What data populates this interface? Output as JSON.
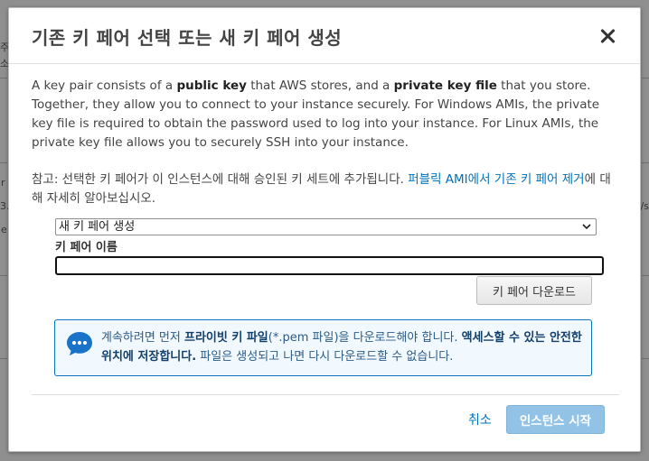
{
  "background": {
    "fragments": [
      "주",
      "소",
      "r",
      "3.",
      "e",
      "/s"
    ]
  },
  "dialog": {
    "title": "기존 키 페어 선택 또는 새 키 페어 생성",
    "description": {
      "p1": "A key pair consists of a ",
      "b1": "public key",
      "p2": " that AWS stores, and a ",
      "b2": "private key file",
      "p3": " that you store. Together, they allow you to connect to your instance securely. For Windows AMIs, the private key file is required to obtain the password used to log into your instance. For Linux AMIs, the private key file allows you to securely SSH into your instance."
    },
    "note": {
      "text": "참고: 선택한 키 페어가 이 인스턴스에 대해 승인된 키 세트에 추가됩니다. ",
      "link": "퍼블릭 AMI에서 기존 키 페어 제거",
      "suffix": "에 대해 자세히 알아보십시오."
    },
    "key_pair_select": {
      "selected": "새 키 페어 생성"
    },
    "key_name_field": {
      "label": "키 페어 이름",
      "value": "",
      "placeholder": ""
    },
    "download_button": "키 페어 다운로드",
    "info": {
      "t1": "계속하려면 먼저 ",
      "b1": "프라이빗 키 파일",
      "t2": "(*.pem 파일)을 다운로드해야 합니다. ",
      "b2": "액세스할 수 있는 안전한 위치에 저장합니다.",
      "t3": " 파일은 생성되고 나면 다시 다운로드할 수 없습니다."
    },
    "cancel_label": "취소",
    "launch_button": "인스턴스 시작"
  },
  "colors": {
    "link": "#0073bb",
    "info_border": "#0a75bf",
    "info_bg": "#f1f9ff",
    "primary_disabled": "#92c3e6"
  },
  "icons": [
    "close-icon",
    "chevron-down-icon",
    "speech-bubble-icon"
  ]
}
